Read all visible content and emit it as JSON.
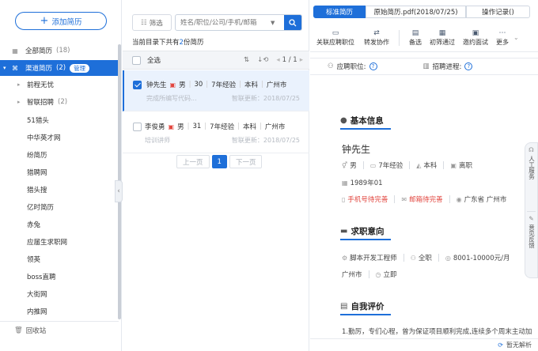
{
  "sidebar": {
    "add_label": "添加简历",
    "all": {
      "label": "全部简历",
      "count": "(18)"
    },
    "channel": {
      "label": "渠道简历",
      "count": "(2)",
      "manage": "管理"
    },
    "sub_items": [
      {
        "label": "前程无忧",
        "count": ""
      },
      {
        "label": "智联招聘",
        "count": "(2)"
      }
    ],
    "items": [
      "51猎头",
      "中华英才网",
      "纷简历",
      "猎聘网",
      "猎头搜",
      "亿时简历",
      "赤兔",
      "应届生求职网",
      "领英",
      "boss直聘",
      "大街网",
      "内推网"
    ],
    "recycle": "回收站"
  },
  "list": {
    "filter_label": "筛选",
    "search_placeholder": "姓名/职位/公司/手机/邮箱",
    "summary_prefix": "当前目录下共有",
    "summary_count": "2",
    "summary_suffix": "份简历",
    "select_all": "全选",
    "page_indicator": "1 / 1",
    "candidates": [
      {
        "name": "钟先生",
        "gender": "男",
        "age": "30",
        "exp": "7年经验",
        "edu": "本科",
        "city": "广州市",
        "sub": "完成所编写代码...",
        "updated": "智联更新：2018/07/25"
      },
      {
        "name": "李俊勇",
        "gender": "男",
        "age": "31",
        "exp": "7年经验",
        "edu": "本科",
        "city": "广州市",
        "sub": "培训讲师",
        "updated": "智联更新：2018/07/25"
      }
    ],
    "prev": "上一页",
    "current_page": "1",
    "next": "下一页"
  },
  "detail": {
    "tabs": [
      "标准简历",
      "原始简历.pdf(2018/07/25)",
      "操作记录()"
    ],
    "toolbar": [
      "关联应聘职位",
      "转发协作",
      "备选",
      "初筛通过",
      "邀约面试",
      "更多"
    ],
    "applied_label": "应聘职位:",
    "progress_label": "招聘进程:",
    "basic_title": "基本信息",
    "name": "钟先生",
    "gender": "男",
    "exp": "7年经验",
    "edu": "本科",
    "status": "离职",
    "birth": "1989年01",
    "phone_hint": "手机号待完善",
    "email_hint": "邮箱待完善",
    "location": "广东省 广州市",
    "intent_title": "求职意向",
    "job": "脚本开发工程师",
    "job_type": "全职",
    "salary": "8001-10000元/月",
    "intent_city": "广州市",
    "start": "立即",
    "eval_title": "自我评价",
    "eval_text": "1.勤厉，专们心程，曾为保证项目顺利完成,连续多个周末主动加班讲度时",
    "float_top": "人工服务",
    "float_bottom": "意见反馈",
    "no_parse": "暂无解析"
  }
}
